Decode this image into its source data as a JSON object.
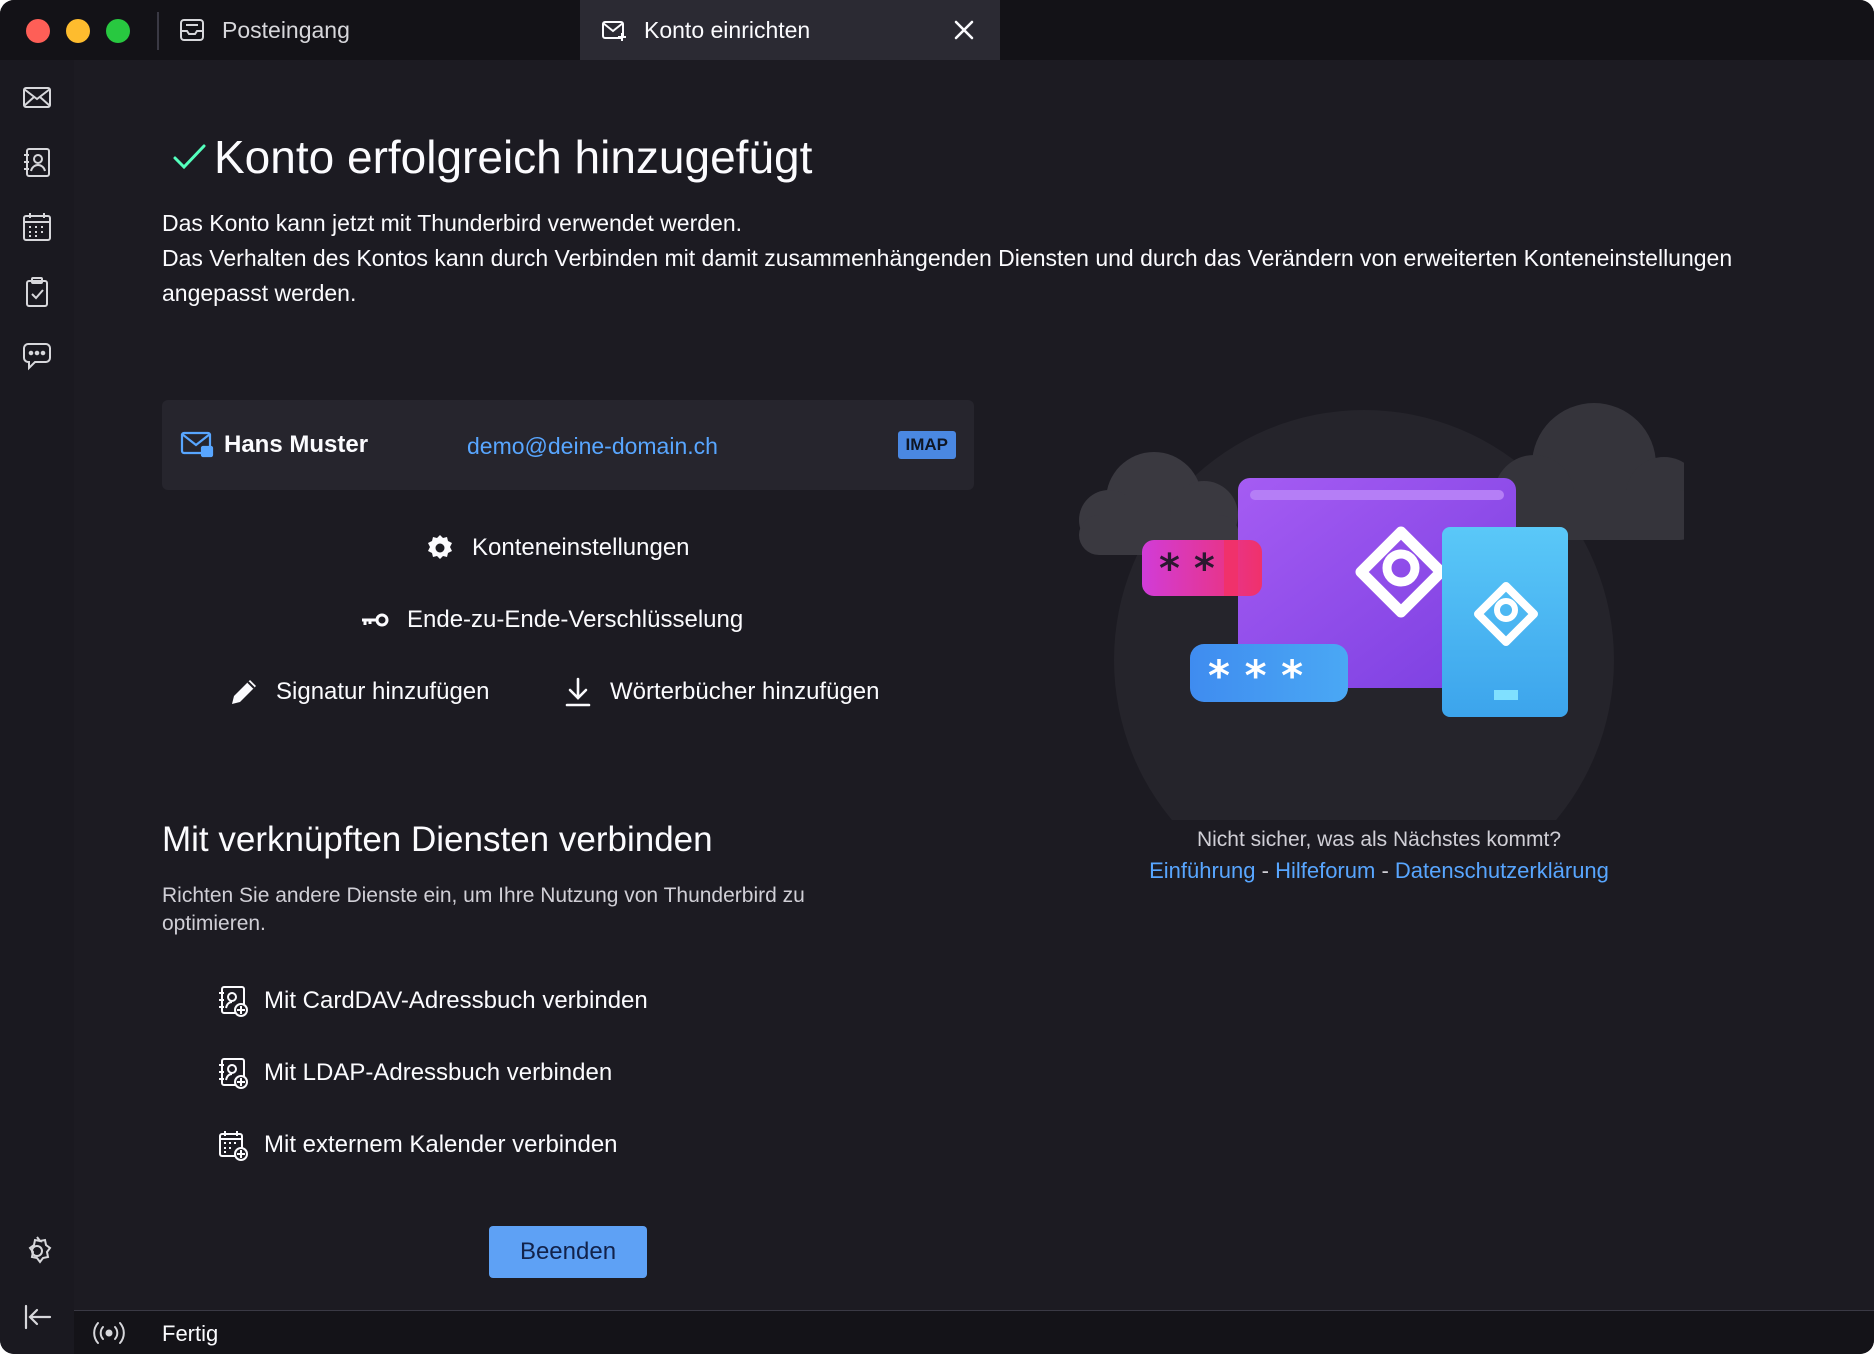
{
  "window": {
    "tabs": [
      {
        "label": "Posteingang",
        "icon": "inbox-icon",
        "active": false
      },
      {
        "label": "Konto einrichten",
        "icon": "account-setup-icon",
        "active": true
      }
    ]
  },
  "spaces": [
    "mail-icon",
    "address-book-icon",
    "calendar-icon",
    "tasks-icon",
    "chat-icon",
    "settings-icon",
    "collapse-sidebar-icon"
  ],
  "main": {
    "title": "Konto erfolgreich hinzugefügt",
    "intro_line1": "Das Konto kann jetzt mit Thunderbird verwendet werden.",
    "intro_line2": "Das Verhalten des Kontos kann durch Verbinden mit damit zusammenhängenden Diensten und durch das Verändern von erweiterten Konteneinstellungen angepasst werden.",
    "account": {
      "name": "Hans Muster",
      "email": "demo@deine-domain.ch",
      "protocol": "IMAP"
    },
    "actions": {
      "settings": "Konteneinstellungen",
      "e2e": "Ende-zu-Ende-Verschlüsselung",
      "signature": "Signatur hinzufügen",
      "dictionaries": "Wörterbücher hinzufügen"
    },
    "services": {
      "title": "Mit verknüpften Diensten verbinden",
      "description": "Richten Sie andere Dienste ein, um Ihre Nutzung von Thunderbird zu optimieren.",
      "carddav": "Mit CardDAV-Adressbuch verbinden",
      "ldap": "Mit LDAP-Adressbuch verbinden",
      "calendar": "Mit externem Kalender verbinden"
    },
    "finish_label": "Beenden",
    "help": {
      "question": "Nicht sicher, was als Nächstes kommt?",
      "link1": "Einführung",
      "sep1": " - ",
      "link2": "Hilfeforum",
      "sep2": " - ",
      "link3": "Datenschutzerklärung"
    }
  },
  "statusbar": {
    "text": "Fertig"
  },
  "colors": {
    "background": "#1c1b22",
    "accent": "#58a6ff",
    "success": "#54ffbd",
    "button": "#5ea1f5"
  }
}
